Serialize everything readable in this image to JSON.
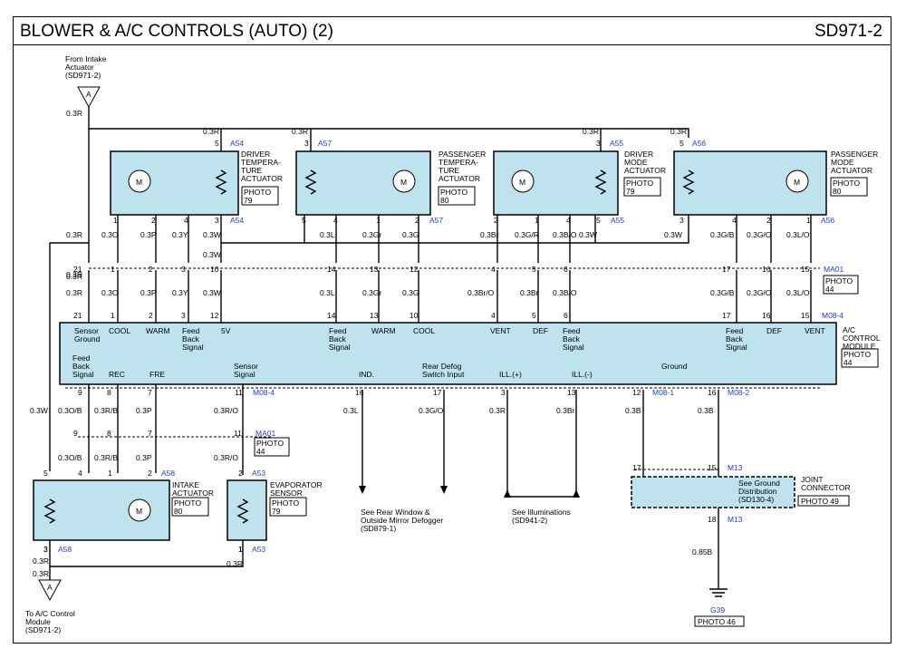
{
  "header": {
    "title": "BLOWER & A/C CONTROLS (AUTO) (2)",
    "code": "SD971-2"
  },
  "refs": {
    "from_intake": [
      "From Intake",
      "Actuator",
      "(SD971-2)"
    ],
    "to_ac": [
      "To A/C Control",
      "Module",
      "(SD971-2)"
    ],
    "rear_window": [
      "See Rear Window &",
      "Outside Mirror Defogger",
      "(SD879-1)"
    ],
    "illum": [
      "See Illuminations",
      "(SD941-2)"
    ],
    "ground_dist": [
      "See Ground",
      "Distribution",
      "(SD130-4)"
    ],
    "connector_letter": "A"
  },
  "components": {
    "driver_temp": {
      "name": [
        "DRIVER",
        "TEMPERA-",
        "TURE",
        "ACTUATOR"
      ],
      "photo": [
        "PHOTO",
        "79"
      ],
      "conn": "A54"
    },
    "pass_temp": {
      "name": [
        "PASSENGER",
        "TEMPERA-",
        "TURE",
        "ACTUATOR"
      ],
      "photo": [
        "PHOTO",
        "80"
      ],
      "conn": "A57"
    },
    "driver_mode": {
      "name": [
        "DRIVER",
        "MODE",
        "ACTUATOR"
      ],
      "photo": [
        "PHOTO",
        "79"
      ],
      "conn": "A55"
    },
    "pass_mode": {
      "name": [
        "PASSENGER",
        "MODE",
        "ACTUATOR"
      ],
      "photo": [
        "PHOTO",
        "80"
      ],
      "conn": "A56"
    },
    "ac_module": {
      "name": [
        "A/C",
        "CONTROL",
        "MODULE"
      ],
      "photo": [
        "PHOTO",
        "44"
      ]
    },
    "intake": {
      "name": [
        "INTAKE",
        "ACTUATOR"
      ],
      "photo": [
        "PHOTO",
        "80"
      ],
      "conn": "A58"
    },
    "evap": {
      "name": [
        "EVAPORATOR",
        "SENSOR"
      ],
      "photo": [
        "PHOTO",
        "79"
      ],
      "conn": "A53"
    },
    "joint": {
      "name": [
        "JOINT",
        "CONNECTOR"
      ],
      "photo": "PHOTO 49"
    },
    "ground": {
      "id": "G39",
      "photo": "PHOTO 46"
    },
    "ma01": {
      "conn": "MA01",
      "photo": [
        "PHOTO",
        "44"
      ]
    },
    "motor": "M"
  },
  "module_labels": {
    "top": [
      "Sensor",
      "Ground",
      "COOL",
      "WARM",
      "Feed",
      "Back",
      "Signal",
      "5V",
      "Feed",
      "Back",
      "Signal",
      "WARM",
      "COOL",
      "VENT",
      "DEF",
      "Feed",
      "Back",
      "Signal",
      "Feed",
      "Back",
      "Signal",
      "DEF",
      "VENT"
    ],
    "bottom": [
      "Feed",
      "Back",
      "Signal",
      "REC",
      "FRE",
      "Sensor",
      "Signal",
      "IND.",
      "Rear Defog",
      "Switch Input",
      "ILL.(+)",
      "ILL.(-)",
      "Ground"
    ]
  },
  "connectors": [
    "M08-4",
    "M08-1",
    "M08-2",
    "M13",
    "M13",
    "MA01",
    "MA01",
    "A54",
    "A57",
    "A55",
    "A56",
    "A58",
    "A53",
    "A58",
    "A53"
  ],
  "wires": [
    "0.3R",
    "0.3R",
    "0.3R",
    "0.3R",
    "0.3R",
    "0.3R",
    "0.3R",
    "0.3O",
    "0.3P",
    "0.3Y",
    "0.3W",
    "0.3W",
    "0.3L",
    "0.3Gr",
    "0.3G",
    "0.3Br",
    "0.3G/R",
    "0.3B/O",
    "0.3W",
    "0.3W",
    "0.3G/B",
    "0.3G/O",
    "0.3L/O",
    "0.3R",
    "0.3O",
    "0.3P",
    "0.3Y",
    "0.3W",
    "0.3L",
    "0.3Gr",
    "0.3G",
    "0.3Br/O",
    "0.3Br",
    "0.3B/O",
    "0.3G/B",
    "0.3G/O",
    "0.3L/O",
    "0.3W",
    "0.3O/B",
    "0.3R/B",
    "0.3P",
    "0.3R/O",
    "0.3O/B",
    "0.3R/B",
    "0.3P",
    "0.3R/O",
    "0.3L",
    "0.3G/O",
    "0.3R",
    "0.3Br",
    "0.3B",
    "0.3B",
    "0.85B",
    "0.3R",
    "0.3R",
    "0.3R",
    "0.3R"
  ],
  "pins": [
    "5",
    "1",
    "2",
    "4",
    "3",
    "3",
    "5",
    "4",
    "1",
    "2",
    "3",
    "2",
    "1",
    "4",
    "5",
    "5",
    "3",
    "4",
    "2",
    "1",
    "21",
    "1",
    "2",
    "3",
    "10",
    "14",
    "13",
    "12",
    "4",
    "5",
    "6",
    "17",
    "16",
    "15",
    "21",
    "1",
    "2",
    "3",
    "12",
    "14",
    "13",
    "10",
    "4",
    "5",
    "6",
    "17",
    "16",
    "15",
    "9",
    "8",
    "7",
    "11",
    "16",
    "17",
    "3",
    "13",
    "12",
    "16",
    "9",
    "8",
    "7",
    "11",
    "5",
    "4",
    "1",
    "2",
    "2",
    "3",
    "1",
    "17",
    "15",
    "18",
    "3",
    "1"
  ]
}
